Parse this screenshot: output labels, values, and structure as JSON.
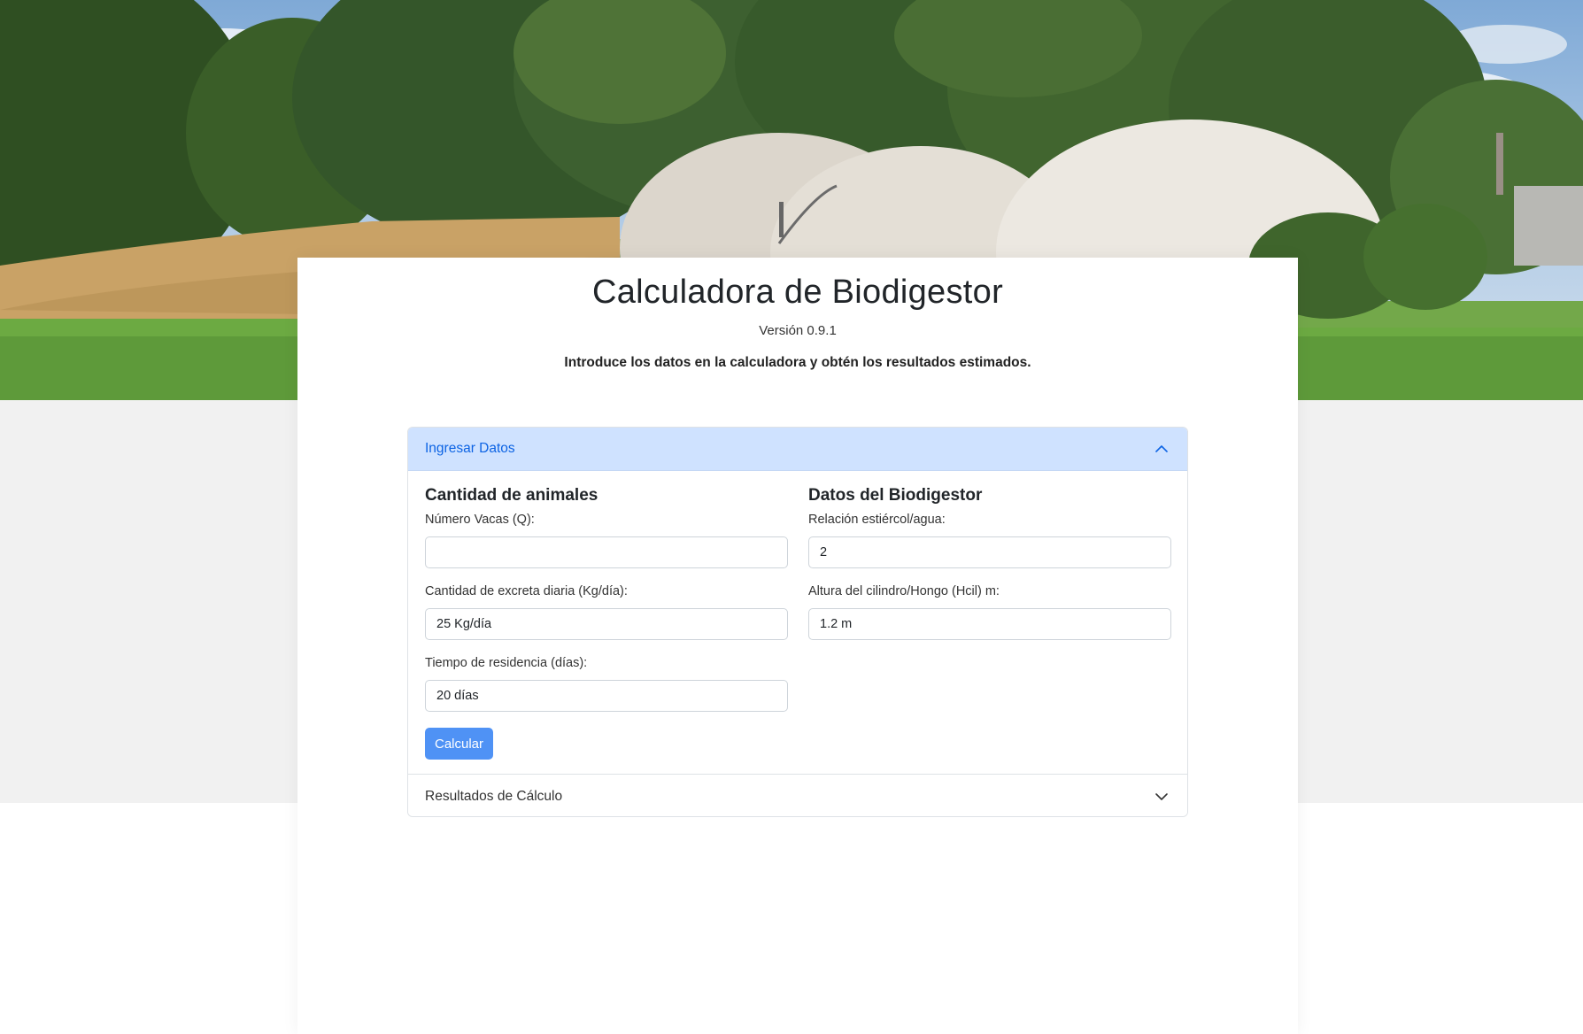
{
  "header": {
    "title": "Calculadora de Biodigestor",
    "version": "Versión 0.9.1",
    "intro": "Introduce los datos en la calculadora y obtén los resultados estimados."
  },
  "accordion": {
    "input_section": {
      "label": "Ingresar Datos",
      "expanded": true,
      "icon": "chevron-up-icon"
    },
    "results_section": {
      "label": "Resultados de Cálculo",
      "expanded": false,
      "icon": "chevron-down-icon"
    }
  },
  "form": {
    "animals": {
      "heading": "Cantidad de animales",
      "cows_label": "Número Vacas (Q):",
      "cows_value": "",
      "excreta_label": "Cantidad de excreta diaria (Kg/día):",
      "excreta_value": "25 Kg/día",
      "residence_label": "Tiempo de residencia (días):",
      "residence_value": "20 días"
    },
    "biodigester": {
      "heading": "Datos del Biodigestor",
      "ratio_label": "Relación estiércol/agua:",
      "ratio_value": "2",
      "height_label": "Altura del cilindro/Hongo (Hcil) m:",
      "height_value": "1.2 m"
    },
    "calculate_label": "Calcular"
  },
  "colors": {
    "accent": "#0c63e4",
    "accordion_header_bg": "#cfe2ff",
    "button_bg": "#4f92f5",
    "page_gray": "#f1f1f1"
  },
  "hero_image": "biodigester-domes-field-photo"
}
